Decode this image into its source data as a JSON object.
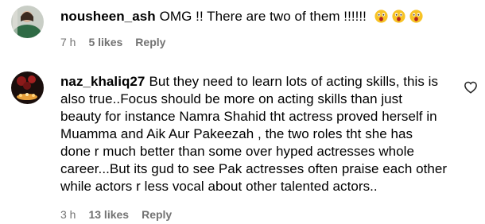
{
  "comments": [
    {
      "username": "nousheen_ash",
      "text": "OMG !! There are two of them !!!!!!",
      "emojis": [
        "astonished-face",
        "astonished-face",
        "astonished-face"
      ],
      "time": "7 h",
      "likes": "5 likes",
      "reply": "Reply"
    },
    {
      "username": "naz_khaliq27",
      "text_lines": [
        "But they need to learn lots of acting skills, this is",
        "also true..Focus should be more on acting skills than just",
        "beauty for instance Namra Shahid tht actress proved herself in",
        "Muamma and Aik Aur Pakeezah , the two roles tht she has",
        "done r much better than some over hyped actresses whole",
        "career...But its gud to see Pak actresses often praise each other",
        "while actors r less vocal about other talented actors.."
      ],
      "time": "3 h",
      "likes": "13 likes",
      "reply": "Reply"
    }
  ],
  "icons": {
    "like": "heart-outline-icon"
  },
  "colors": {
    "meta_text": "#737373",
    "text": "#000000"
  }
}
